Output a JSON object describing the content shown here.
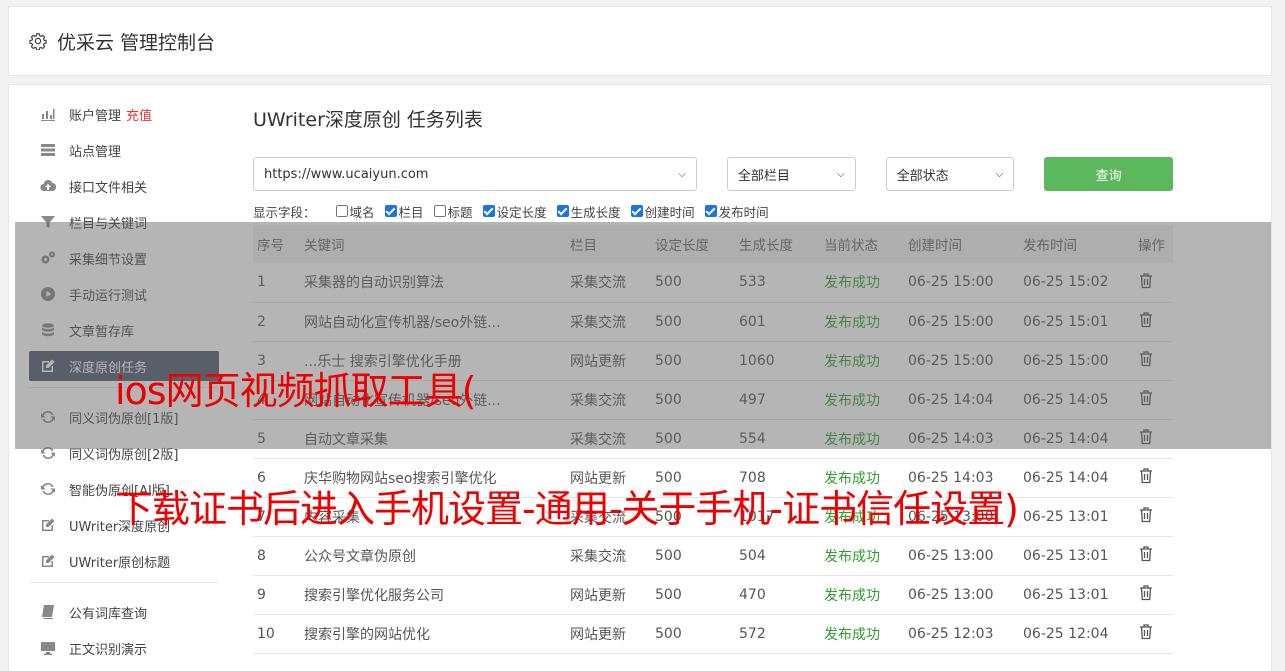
{
  "header": {
    "title": "优采云 管理控制台",
    "icon": "gear-icon"
  },
  "sidebar": {
    "items": [
      {
        "label": "账户管理",
        "extra": "充值",
        "icon": "bar-chart-icon"
      },
      {
        "label": "站点管理",
        "icon": "server-icon"
      },
      {
        "label": "接口文件相关",
        "icon": "cloud-upload-icon"
      },
      {
        "label": "栏目与关键词",
        "icon": "filter-icon"
      },
      {
        "label": "采集细节设置",
        "icon": "cogs-icon"
      },
      {
        "label": "手动运行测试",
        "icon": "play-circle-icon"
      },
      {
        "label": "文章暂存库",
        "icon": "database-icon"
      },
      {
        "label": "深度原创任务",
        "icon": "edit-icon",
        "active": true
      }
    ],
    "items2": [
      {
        "label": "同义词伪原创[1版]",
        "icon": "refresh-icon"
      },
      {
        "label": "同义词伪原创[2版]",
        "icon": "refresh-icon"
      },
      {
        "label": "智能伪原创[AI版]",
        "icon": "refresh-icon"
      },
      {
        "label": "UWriter深度原创",
        "icon": "edit-icon"
      },
      {
        "label": "UWriter原创标题",
        "icon": "edit-icon"
      }
    ],
    "items3": [
      {
        "label": "公有词库查询",
        "icon": "book-icon"
      },
      {
        "label": "正文识别演示",
        "icon": "monitor-icon"
      }
    ]
  },
  "main": {
    "title": "UWriter深度原创 任务列表",
    "filters": {
      "site": "https://www.ucaiyun.com",
      "column": "全部栏目",
      "status": "全部状态",
      "query_label": "查询"
    },
    "fields": {
      "label": "显示字段：",
      "options": [
        {
          "label": "域名",
          "checked": false
        },
        {
          "label": "栏目",
          "checked": true
        },
        {
          "label": "标题",
          "checked": false
        },
        {
          "label": "设定长度",
          "checked": true
        },
        {
          "label": "生成长度",
          "checked": true
        },
        {
          "label": "创建时间",
          "checked": true
        },
        {
          "label": "发布时间",
          "checked": true
        }
      ]
    },
    "table": {
      "headers": [
        "序号",
        "关键词",
        "栏目",
        "设定长度",
        "生成长度",
        "当前状态",
        "创建时间",
        "发布时间",
        "操作"
      ],
      "rows": [
        [
          "1",
          "采集器的自动识别算法",
          "采集交流",
          "500",
          "533",
          "发布成功",
          "06-25 15:00",
          "06-25 15:02"
        ],
        [
          "2",
          "网站自动化宣传机器/seo外链...",
          "采集交流",
          "500",
          "601",
          "发布成功",
          "06-25 15:00",
          "06-25 15:01"
        ],
        [
          "3",
          "...乐士 搜索引擎优化手册",
          "网站更新",
          "500",
          "1060",
          "发布成功",
          "06-25 15:00",
          "06-25 15:00"
        ],
        [
          "4",
          "网站自动化宣传机器/seo外链...",
          "采集交流",
          "500",
          "497",
          "发布成功",
          "06-25 14:04",
          "06-25 14:05"
        ],
        [
          "5",
          "自动文章采集",
          "采集交流",
          "500",
          "554",
          "发布成功",
          "06-25 14:03",
          "06-25 14:04"
        ],
        [
          "6",
          "庆华购物网站seo搜索引擎优化",
          "网站更新",
          "500",
          "708",
          "发布成功",
          "06-25 14:03",
          "06-25 14:04"
        ],
        [
          "7",
          "内容采集",
          "采集交流",
          "500",
          "1017",
          "发布成功",
          "06-25 13:00",
          "06-25 13:01"
        ],
        [
          "8",
          "公众号文章伪原创",
          "采集交流",
          "500",
          "504",
          "发布成功",
          "06-25 13:00",
          "06-25 13:01"
        ],
        [
          "9",
          "搜索引擎优化服务公司",
          "网站更新",
          "500",
          "470",
          "发布成功",
          "06-25 13:00",
          "06-25 13:01"
        ],
        [
          "10",
          "搜索引擎的网站优化",
          "网站更新",
          "500",
          "572",
          "发布成功",
          "06-25 12:03",
          "06-25 12:04"
        ]
      ]
    }
  },
  "overlay": {
    "line1": "ios网页视频抓取工具(",
    "line2": "下载证书后进入手机设置-通用-关于手机-证书信任设置)"
  },
  "colors": {
    "accent": "#5cb85c",
    "active_nav": "#4e5b6e",
    "success": "#2e9e2e",
    "overlay_text": "#ee0000"
  }
}
